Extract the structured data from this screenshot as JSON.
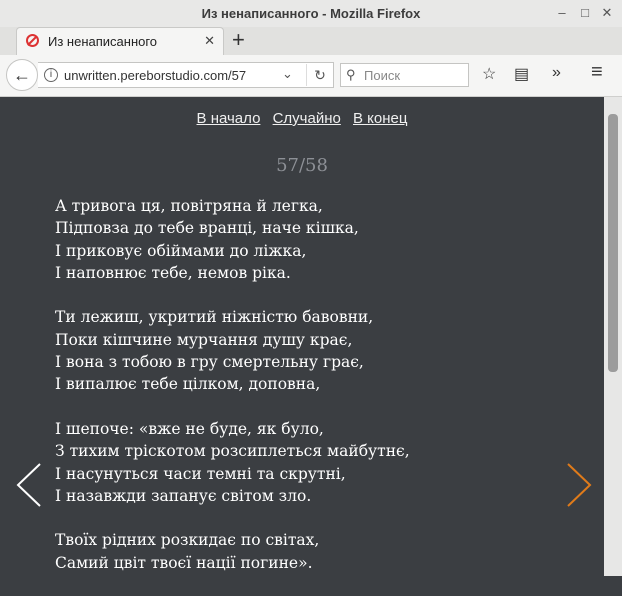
{
  "window": {
    "title": "Из ненаписанного - Mozilla Firefox",
    "minimize": "–",
    "maximize": "□",
    "close": "✕"
  },
  "tab": {
    "label": "Из ненаписанного",
    "close": "✕",
    "new_tab": "+"
  },
  "navbar": {
    "back": "←",
    "url": "unwritten.pereborstudio.com/57",
    "url_dropdown": "⌄",
    "reload": "↻",
    "search_icon": "⚲",
    "search_placeholder": "Поиск",
    "bookmark": "☆",
    "reader": "▤",
    "overflow": "»",
    "menu": "≡"
  },
  "page_nav": {
    "start": "В начало",
    "random": "Случайно",
    "end": "В конец"
  },
  "page_counter": "57/58",
  "poem": {
    "stanzas": [
      [
        "А тривога ця, повітряна й легка,",
        "Підповза до тебе вранці, наче кішка,",
        "І приковує обіймами до ліжка,",
        "І наповнює тебе, немов ріка."
      ],
      [
        "Ти лежиш, укритий ніжністю бавовни,",
        "Поки кішчине мурчання душу крає,",
        "І вона з тобою в гру смертельну грає,",
        "І випалює тебе цілком, доповна,"
      ],
      [
        "І шепоче: «вже не буде, як було,",
        "З тихим тріскотом розсиплеться майбутнє,",
        "І насунуться часи темні та скрутні,",
        "І назавжди запанує світом зло."
      ],
      [
        "Твоїх рідних розкидає по світах,",
        "Самий цвіт твоєї нації погине»."
      ]
    ]
  },
  "colors": {
    "background": "#3b3e42",
    "text": "#ffffff",
    "counter": "#8d9096",
    "prev_arrow": "#ffffff",
    "next_arrow": "#e07b1a"
  },
  "icons": {
    "prev": "chevron-left-icon",
    "next": "chevron-right-icon"
  }
}
